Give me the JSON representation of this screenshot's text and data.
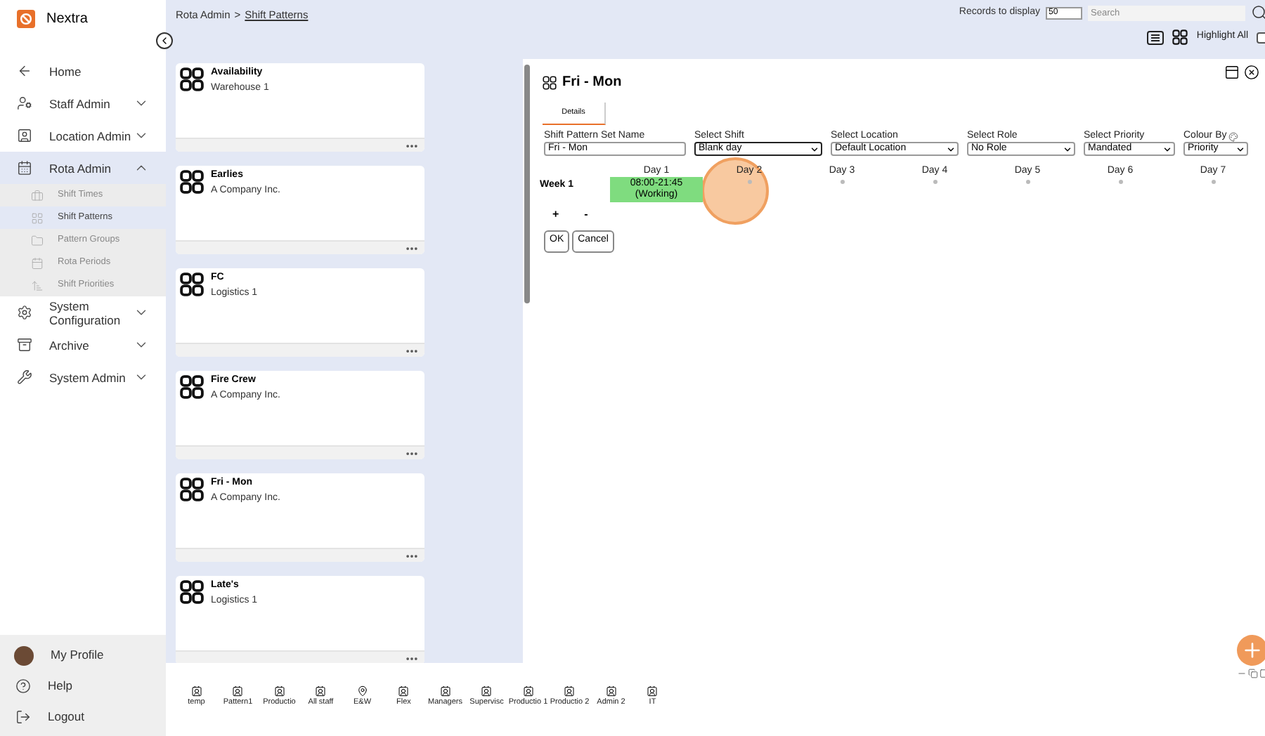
{
  "app": {
    "name": "Nextra"
  },
  "sidebar": {
    "items": [
      {
        "label": "Home",
        "kind": "link"
      },
      {
        "label": "Staff Admin",
        "kind": "group",
        "expanded": false
      },
      {
        "label": "Location Admin",
        "kind": "group",
        "expanded": false
      },
      {
        "label": "Rota Admin",
        "kind": "group",
        "expanded": true,
        "children": [
          {
            "label": "Shift Times",
            "selected": false
          },
          {
            "label": "Shift Patterns",
            "selected": true
          },
          {
            "label": "Pattern Groups",
            "selected": false
          },
          {
            "label": "Rota Periods",
            "selected": false
          },
          {
            "label": "Shift Priorities",
            "selected": false
          }
        ]
      },
      {
        "label": "System Configuration",
        "kind": "group",
        "expanded": false
      },
      {
        "label": "Archive",
        "kind": "group",
        "expanded": false
      },
      {
        "label": "System Admin",
        "kind": "group",
        "expanded": false
      }
    ],
    "footer": [
      {
        "label": "My Profile"
      },
      {
        "label": "Help"
      },
      {
        "label": "Logout"
      }
    ]
  },
  "breadcrumb": {
    "parent": "Rota Admin",
    "separator": ">",
    "current": "Shift Patterns"
  },
  "toolbar": {
    "records_label": "Records to display",
    "records_value": "50",
    "search": {
      "placeholder": "Search"
    },
    "highlight_all": {
      "label": "Highlight All",
      "checked": false
    }
  },
  "cards": [
    {
      "title": "Availability",
      "subtitle": "Warehouse 1"
    },
    {
      "title": "Earlies",
      "subtitle": "A Company Inc."
    },
    {
      "title": "FC",
      "subtitle": "Logistics 1"
    },
    {
      "title": "Fire Crew",
      "subtitle": "A Company Inc."
    },
    {
      "title": "Fri - Mon",
      "subtitle": "A Company Inc."
    },
    {
      "title": "Late's",
      "subtitle": "Logistics 1"
    }
  ],
  "panel": {
    "title": "Fri - Mon",
    "tabs": [
      {
        "label": "Details",
        "selected": true
      }
    ],
    "fields": [
      {
        "label": "Shift Pattern Set Name",
        "kind": "text",
        "value": "Fri - Mon",
        "focused": false
      },
      {
        "label": "Select Shift",
        "kind": "select",
        "value": "Blank day",
        "focused": true
      },
      {
        "label": "Select Location",
        "kind": "select",
        "value": "Default Location",
        "focused": false
      },
      {
        "label": "Select Role",
        "kind": "select",
        "value": "No Role",
        "focused": false
      },
      {
        "label": "Select Priority",
        "kind": "select",
        "value": "Mandated",
        "focused": false
      },
      {
        "label": "Colour By",
        "kind": "select",
        "value": "Priority",
        "focused": false
      }
    ],
    "week": {
      "label": "Week 1",
      "days": [
        {
          "label": "Day 1",
          "time": "08:00-21:45",
          "status": "(Working)"
        },
        {
          "label": "Day 2"
        },
        {
          "label": "Day 3"
        },
        {
          "label": "Day 4"
        },
        {
          "label": "Day 5"
        },
        {
          "label": "Day 6"
        },
        {
          "label": "Day 7"
        }
      ]
    },
    "add": "+",
    "remove": "-",
    "buttons": [
      "OK",
      "Cancel"
    ]
  },
  "dock": [
    {
      "label": "temp",
      "kind": "person"
    },
    {
      "label": "Pattern1",
      "kind": "person"
    },
    {
      "label": "Productio",
      "kind": "person"
    },
    {
      "label": "All staff",
      "kind": "person"
    },
    {
      "label": "E&W",
      "kind": "pin"
    },
    {
      "label": "Flex",
      "kind": "person"
    },
    {
      "label": "Managers",
      "kind": "person"
    },
    {
      "label": "Supervisc",
      "kind": "person"
    },
    {
      "label": "Productio 1",
      "kind": "person"
    },
    {
      "label": "Productio 2",
      "kind": "person"
    },
    {
      "label": "Admin 2",
      "kind": "person"
    },
    {
      "label": "IT",
      "kind": "person"
    }
  ]
}
